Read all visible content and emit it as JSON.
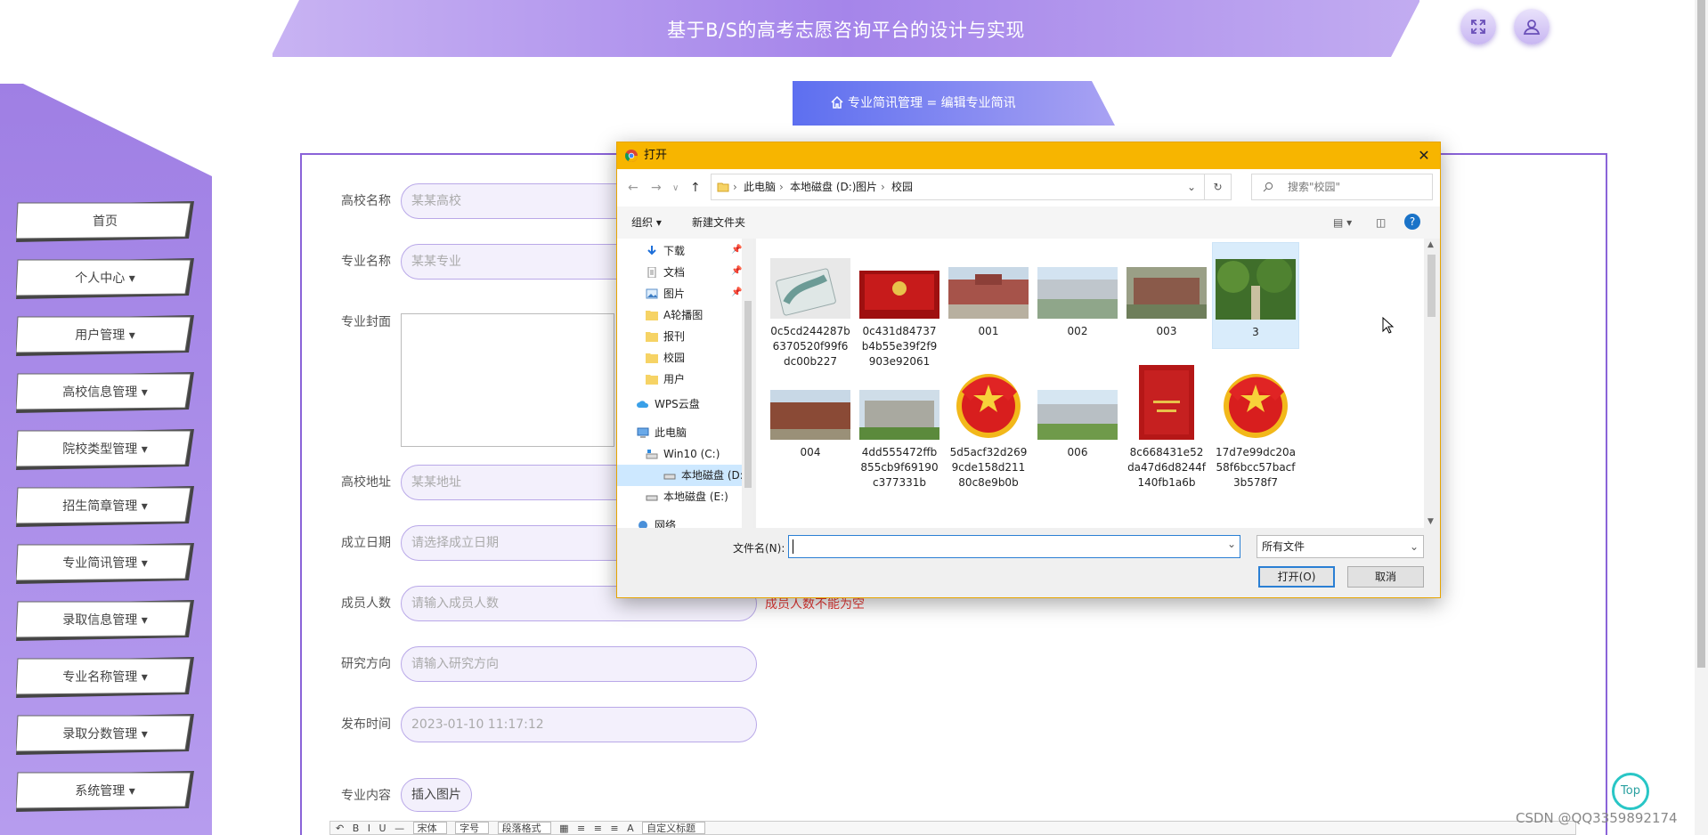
{
  "app": {
    "title": "基于B/S的高考志愿咨询平台的设计与实现"
  },
  "sidebar": {
    "items": [
      {
        "label": "首页"
      },
      {
        "label": "个人中心 ▾"
      },
      {
        "label": "用户管理 ▾"
      },
      {
        "label": "高校信息管理 ▾"
      },
      {
        "label": "院校类型管理 ▾"
      },
      {
        "label": "招生简章管理 ▾"
      },
      {
        "label": "专业简讯管理 ▾"
      },
      {
        "label": "录取信息管理 ▾"
      },
      {
        "label": "专业名称管理 ▾"
      },
      {
        "label": "录取分数管理 ▾"
      },
      {
        "label": "系统管理 ▾"
      }
    ]
  },
  "breadcrumb": {
    "text": "专业简讯管理  =  编辑专业简讯"
  },
  "form": {
    "school_name": {
      "label": "高校名称",
      "placeholder": "某某高校"
    },
    "major_name": {
      "label": "专业名称",
      "placeholder": "某某专业"
    },
    "cover": {
      "label": "专业封面"
    },
    "address": {
      "label": "高校地址",
      "placeholder": "某某地址"
    },
    "found_date": {
      "label": "成立日期",
      "placeholder": "请选择成立日期"
    },
    "members": {
      "label": "成员人数",
      "placeholder": "请输入成员人数",
      "error": "成员人数不能为空"
    },
    "research": {
      "label": "研究方向",
      "placeholder": "请输入研究方向"
    },
    "publish_time": {
      "label": "发布时间",
      "value": "2023-01-10 11:17:12"
    },
    "content": {
      "label": "专业内容",
      "insert_button": "插入图片"
    }
  },
  "editor_toolbar": {
    "font": "宋体",
    "size": "字号",
    "format": "段落格式",
    "custom_title": "自定义标题"
  },
  "top_button": "Top",
  "watermark": "CSDN @QQ3359892174",
  "dialog": {
    "title": "打开",
    "path": [
      "此电脑",
      "本地磁盘 (D:)",
      "图片",
      "校园"
    ],
    "search_placeholder": "搜索\"校园\"",
    "organize": "组织 ▾",
    "new_folder": "新建文件夹",
    "nav_items": [
      {
        "label": "下载",
        "pinned": true
      },
      {
        "label": "文档",
        "pinned": true
      },
      {
        "label": "图片",
        "pinned": true
      },
      {
        "label": "A轮播图"
      },
      {
        "label": "报刊"
      },
      {
        "label": "校园"
      },
      {
        "label": "用户"
      },
      {
        "label": "WPS云盘"
      },
      {
        "label": "此电脑"
      },
      {
        "label": "Win10 (C:)"
      },
      {
        "label": "本地磁盘 (D:)",
        "selected": true
      },
      {
        "label": "本地磁盘 (E:)"
      },
      {
        "label": "网络"
      }
    ],
    "files": [
      {
        "name": "0c5cd244287b6370520f99f6dc00b227",
        "icon": "card-image"
      },
      {
        "name": "0c431d84737b4b55e39f2f9903e92061",
        "icon": "red-book-image"
      },
      {
        "name": "001",
        "icon": "campus-image"
      },
      {
        "name": "002",
        "icon": "campus-image"
      },
      {
        "name": "003",
        "icon": "campus-image"
      },
      {
        "name": "3",
        "icon": "trees-image",
        "selected": true
      },
      {
        "name": "004",
        "icon": "campus-image"
      },
      {
        "name": "4dd555472ffb855cb9f69190c377331b",
        "icon": "campus-image"
      },
      {
        "name": "5d5acf32d2699cde158d21180c8e9b0b",
        "icon": "league-badge-image"
      },
      {
        "name": "006",
        "icon": "campus-image"
      },
      {
        "name": "8c668431e52da47d6d8244f140fb1a6b",
        "icon": "red-book-image"
      },
      {
        "name": "17d7e99dc20a58f6bcc57bacf3b578f7",
        "icon": "league-badge-image"
      }
    ],
    "filename_label": "文件名(N):",
    "filename_value": "",
    "filetype": "所有文件",
    "open_button": "打开(O)",
    "cancel_button": "取消"
  },
  "colors": {
    "accent": "#8a63d8",
    "sidebar_bg": "#a98be6",
    "dialog_titlebar": "#f7b500",
    "error": "#e53935"
  }
}
